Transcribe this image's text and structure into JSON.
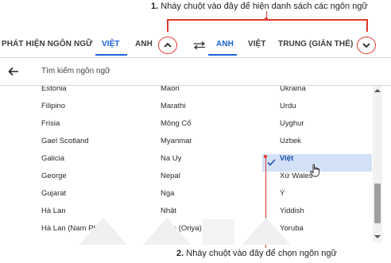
{
  "callouts": {
    "top_num": "1.",
    "top_text": " Nháy chuột vào đây để hiện danh sách các ngôn ngữ",
    "bottom_num": "2.",
    "bottom_text": " Nháy chuột vào đây để chọn ngôn ngữ"
  },
  "source_tabs": {
    "detect": "PHÁT HIỆN NGÔN NGỮ",
    "vi": "VIỆT",
    "en": "ANH"
  },
  "target_tabs": {
    "en": "ANH",
    "vi": "VIỆT",
    "zh": "TRUNG (GIẢN THỂ)"
  },
  "search": {
    "placeholder": "Tìm kiếm ngôn ngữ"
  },
  "languages": {
    "col1": [
      "Estonia",
      "Filipino",
      "Frisia",
      "Gael Scotland",
      "Galicia",
      "George",
      "Gujarat",
      "Hà Lan",
      "Hà Lan (Nam Phi)"
    ],
    "col2": [
      "Maori",
      "Marathi",
      "Mông Cổ",
      "Myanmar",
      "Na Uy",
      "Nepal",
      "Nga",
      "Nhật",
      "Odia (Oriya)"
    ],
    "col3": [
      "Ukraina",
      "Urdu",
      "Uyghur",
      "Uzbek",
      "Việt",
      "Xứ Wales",
      "Ý",
      "Yiddish",
      "Yoruba"
    ]
  },
  "selected_language": "Việt",
  "colors": {
    "accent": "#1a62d6",
    "callout_red": "#e0382c",
    "selected_bg": "#d3e1f7"
  }
}
